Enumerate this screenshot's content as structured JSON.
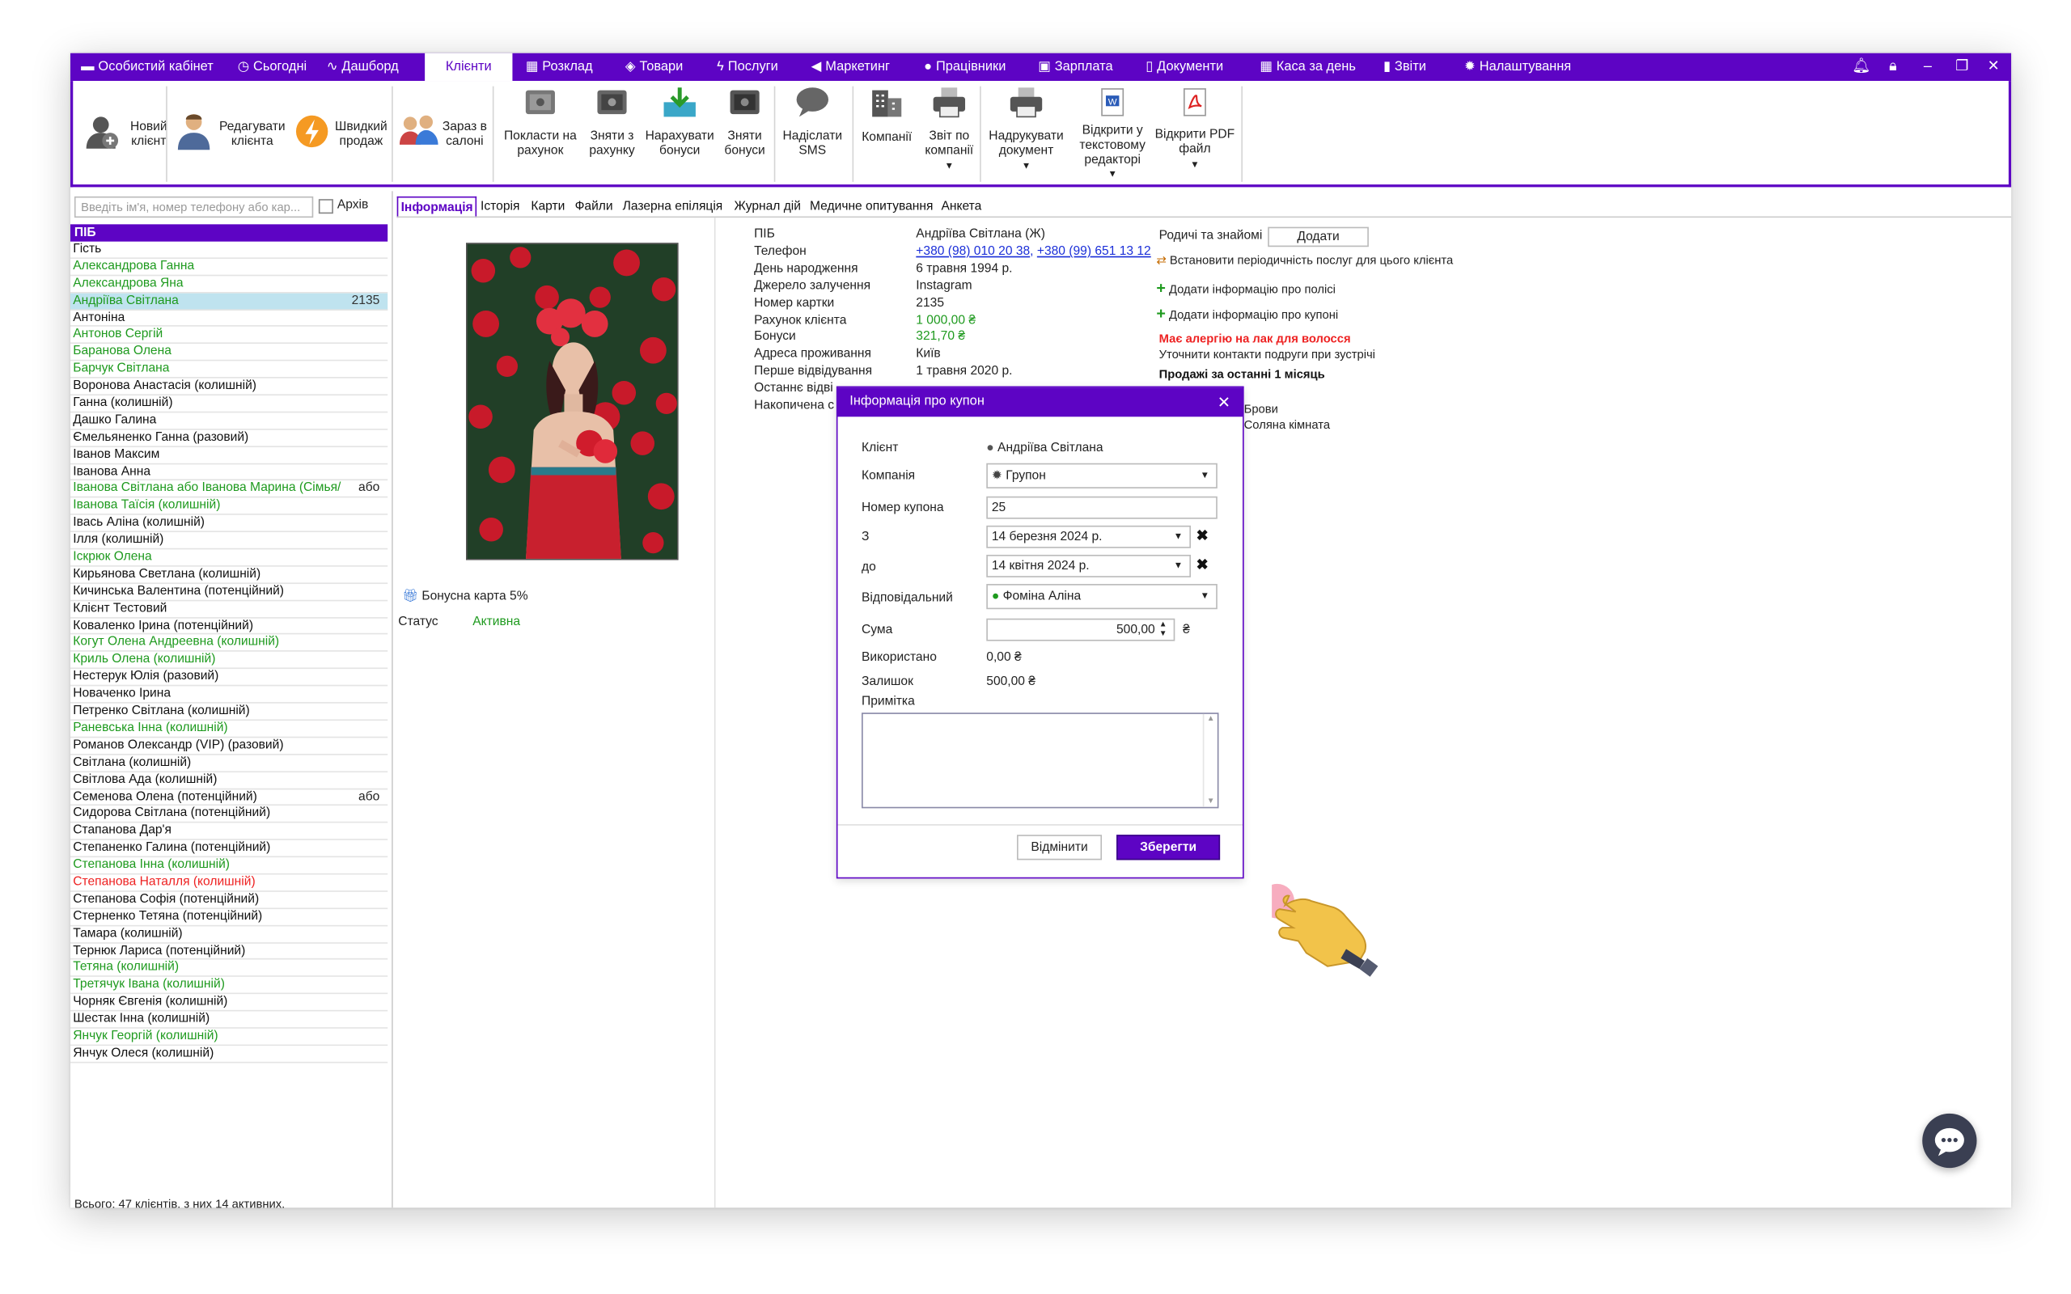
{
  "menu": {
    "items": [
      {
        "label": "Особистий кабінет",
        "icon": "wallet-icon"
      },
      {
        "label": "Сьогодні",
        "icon": "clock-icon"
      },
      {
        "label": "Дашборд",
        "icon": "pulse-icon"
      },
      {
        "label": "Клієнти",
        "icon": "users-icon"
      },
      {
        "label": "Розклад",
        "icon": "calendar-icon"
      },
      {
        "label": "Товари",
        "icon": "box-icon"
      },
      {
        "label": "Послуги",
        "icon": "lightning-icon"
      },
      {
        "label": "Маркетинг",
        "icon": "megaphone-icon"
      },
      {
        "label": "Працівники",
        "icon": "person-icon"
      },
      {
        "label": "Зарплата",
        "icon": "money-icon"
      },
      {
        "label": "Документи",
        "icon": "document-icon"
      },
      {
        "label": "Каса за день",
        "icon": "calculator-icon"
      },
      {
        "label": "Звіти",
        "icon": "bar-chart-icon"
      },
      {
        "label": "Налаштування",
        "icon": "gear-icon"
      }
    ],
    "active": "Клієнти"
  },
  "ribbon": {
    "new_client": "Новий клієнт",
    "edit_client": "Редагувати клієнта",
    "quick_sale": "Швидкий продаж",
    "in_salon": "Зараз в салоні",
    "to_account": "Покласти на рахунок",
    "from_account": "Зняти з рахунку",
    "add_bonus": "Нарахувати бонуси",
    "remove_bonus": "Зняти бонуси",
    "send_sms": "Надіслати SMS",
    "companies": "Компанії",
    "company_report": "Звіт по компанії",
    "print_doc": "Надрукувати документ",
    "open_editor": "Відкрити у текстовому редакторі",
    "open_pdf": "Відкрити PDF файл"
  },
  "left": {
    "search_placeholder": "Введіть ім'я, номер телефону або кар...",
    "archive_label": "Архів",
    "column_header": "ПІБ",
    "clients": [
      {
        "name": "Гість",
        "color": "black",
        "extra": ""
      },
      {
        "name": "Александрова Ганна",
        "color": "green",
        "extra": ""
      },
      {
        "name": "Александрова Яна",
        "color": "green",
        "extra": ""
      },
      {
        "name": "Андріїва Світлана",
        "color": "green",
        "extra": "2135",
        "selected": true
      },
      {
        "name": "Антоніна",
        "color": "black",
        "extra": ""
      },
      {
        "name": "Антонов Сергій",
        "color": "green",
        "extra": ""
      },
      {
        "name": "Баранова Олена",
        "color": "green",
        "extra": ""
      },
      {
        "name": "Барчук Світлана",
        "color": "green",
        "extra": ""
      },
      {
        "name": "Воронова Анастасія (колишній)",
        "color": "black",
        "extra": ""
      },
      {
        "name": "Ганна (колишній)",
        "color": "black",
        "extra": ""
      },
      {
        "name": "Дашко Галина",
        "color": "black",
        "extra": ""
      },
      {
        "name": "Ємельяненко Ганна (разовий)",
        "color": "black",
        "extra": ""
      },
      {
        "name": "Іванов Максим",
        "color": "black",
        "extra": ""
      },
      {
        "name": "Іванова Анна",
        "color": "black",
        "extra": ""
      },
      {
        "name": "Іванова Світлана  або Іванова  Марина (Сімья/",
        "color": "green",
        "extra": "або"
      },
      {
        "name": "Іванова Таїсія (колишній)",
        "color": "green",
        "extra": ""
      },
      {
        "name": "Івась Аліна (колишній)",
        "color": "black",
        "extra": ""
      },
      {
        "name": "Ілля (колишній)",
        "color": "black",
        "extra": ""
      },
      {
        "name": "Іскрюк Олена",
        "color": "green",
        "extra": ""
      },
      {
        "name": "Кирьянова Светлана (колишній)",
        "color": "black",
        "extra": ""
      },
      {
        "name": "Кичинська Валентина (потенційний)",
        "color": "black",
        "extra": ""
      },
      {
        "name": "Клієнт Тестовий",
        "color": "black",
        "extra": ""
      },
      {
        "name": "Коваленко Ірина (потенційний)",
        "color": "black",
        "extra": ""
      },
      {
        "name": "Когут Олена Андреевна (колишній)",
        "color": "green",
        "extra": ""
      },
      {
        "name": "Криль Олена (колишній)",
        "color": "green",
        "extra": ""
      },
      {
        "name": "Нестерук Юлія (разовий)",
        "color": "black",
        "extra": ""
      },
      {
        "name": "Новаченко Ірина",
        "color": "black",
        "extra": ""
      },
      {
        "name": "Петренко Світлана (колишній)",
        "color": "black",
        "extra": ""
      },
      {
        "name": "Раневська Інна (колишній)",
        "color": "green",
        "extra": ""
      },
      {
        "name": "Романов Олександр (VIP) (разовий)",
        "color": "black",
        "extra": ""
      },
      {
        "name": "Світлана (колишній)",
        "color": "black",
        "extra": ""
      },
      {
        "name": "Світлова Ада (колишній)",
        "color": "black",
        "extra": ""
      },
      {
        "name": "Семенова Олена (потенційний)",
        "color": "black",
        "extra": "або"
      },
      {
        "name": "Сидорова Світлана (потенційний)",
        "color": "black",
        "extra": ""
      },
      {
        "name": "Стапанова Дар'я",
        "color": "black",
        "extra": ""
      },
      {
        "name": "Степаненко Галина (потенційний)",
        "color": "black",
        "extra": ""
      },
      {
        "name": "Степанова Інна (колишній)",
        "color": "green",
        "extra": ""
      },
      {
        "name": "Степанова Наталля (колишній)",
        "color": "red",
        "extra": ""
      },
      {
        "name": "Степанова Софія (потенційний)",
        "color": "black",
        "extra": ""
      },
      {
        "name": "Стерненко Тетяна (потенційний)",
        "color": "black",
        "extra": ""
      },
      {
        "name": "Тамара (колишній)",
        "color": "black",
        "extra": ""
      },
      {
        "name": "Тернюк Лариса (потенційний)",
        "color": "black",
        "extra": ""
      },
      {
        "name": "Тетяна (колишній)",
        "color": "green",
        "extra": ""
      },
      {
        "name": "Третячук Івана (колишній)",
        "color": "green",
        "extra": ""
      },
      {
        "name": "Чорняк Євгенія (колишній)",
        "color": "black",
        "extra": ""
      },
      {
        "name": "Шестак Інна (колишній)",
        "color": "black",
        "extra": ""
      },
      {
        "name": "Янчук Георгій (колишній)",
        "color": "green",
        "extra": ""
      },
      {
        "name": "Янчук Олеся (колишній)",
        "color": "black",
        "extra": ""
      }
    ],
    "total": "Всього: 47 клієнтів, з них 14 активних."
  },
  "tabs": [
    "Інформація",
    "Історія",
    "Карти",
    "Файли",
    "Лазерна епіляція",
    "Журнал дій",
    "Медичне опитування",
    "Анкета"
  ],
  "card": {
    "bonus_card": "Бонусна карта 5%",
    "status_label": "Статус",
    "status_value": "Активна"
  },
  "info": {
    "fields": [
      {
        "label": "ПІБ",
        "value": "Андріїва Світлана (Ж)"
      },
      {
        "label": "Телефон",
        "value": ""
      },
      {
        "label": "День народження",
        "value": "6 травня 1994 р."
      },
      {
        "label": "Джерело залучення",
        "value": "Instagram"
      },
      {
        "label": "Номер картки",
        "value": "2135"
      },
      {
        "label": "Рахунок клієнта",
        "value": "1 000,00 ₴"
      },
      {
        "label": "Бонуси",
        "value": "321,70 ₴"
      },
      {
        "label": "Адреса проживання",
        "value": "Київ"
      },
      {
        "label": "Перше відвідування",
        "value": "1 травня 2020 р."
      },
      {
        "label": "Останнє відві",
        "value": ""
      },
      {
        "label": "Накопичена с",
        "value": ""
      }
    ],
    "phone1": "+380 (98) 010 20 38",
    "phone2": "+380 (99) 651 13 12",
    "sep": ", "
  },
  "right": {
    "relatives_label": "Родичі та знайомі",
    "add_button": "Додати",
    "set_periodicity": "Встановити періодичність послуг для цього клієнта",
    "add_policy": "Додати інформацію про полісі",
    "add_coupon": "Додати інформацію про купоні",
    "allergy": "Має алергію на лак для волосся",
    "note": "Уточнити контакти подруги при зустрічі",
    "sales_header": "Продажі за останні 1 місяць",
    "item1": "Брови",
    "item2": "Соляна кімната"
  },
  "modal": {
    "title": "Інформація про купон",
    "client_label": "Клієнт",
    "client_value": "Андріїва Світлана",
    "company_label": "Компанія",
    "company_value": "Групон",
    "coupon_label": "Номер купона",
    "coupon_value": "25",
    "from_label": "З",
    "from_value": "14  березня  2024 р.",
    "to_label": "до",
    "to_value": "14  квітня  2024 р.",
    "responsible_label": "Відповідальний",
    "responsible_value": "Фоміна Аліна",
    "sum_label": "Сума",
    "sum_value": "500,00",
    "currency": "₴",
    "used_label": "Використано",
    "used_value": "0,00 ₴",
    "rest_label": "Залишок",
    "rest_value": "500,00 ₴",
    "note_label": "Примітка",
    "cancel": "Відмінити",
    "save": "Зберегти"
  },
  "colors": {
    "accent": "#5d04c4",
    "green": "#1e9a1e",
    "red": "#e22222",
    "link": "#1a2ed8"
  }
}
